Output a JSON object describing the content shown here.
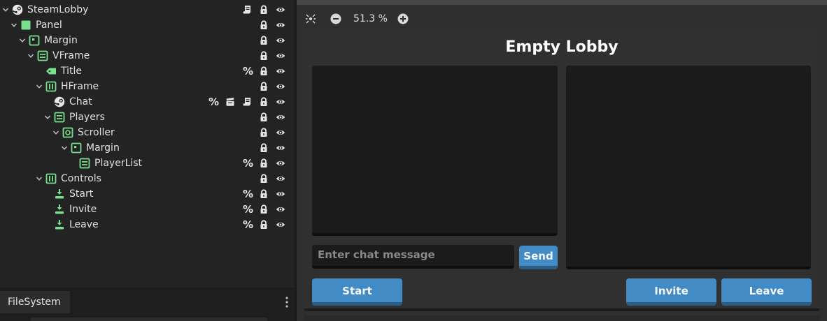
{
  "scene_tree": [
    {
      "id": "steamlobby",
      "label": "SteamLobby",
      "depth": 0,
      "chevron": true,
      "icon": "steam-node-icon",
      "percent": false,
      "clapper": false,
      "script": true
    },
    {
      "id": "panel",
      "label": "Panel",
      "depth": 1,
      "chevron": true,
      "icon": "panel-node-icon",
      "percent": false,
      "clapper": false,
      "script": false
    },
    {
      "id": "margin",
      "label": "Margin",
      "depth": 2,
      "chevron": true,
      "icon": "margin-container-icon",
      "percent": false,
      "clapper": false,
      "script": false
    },
    {
      "id": "vframe",
      "label": "VFrame",
      "depth": 3,
      "chevron": true,
      "icon": "vbox-container-icon",
      "percent": false,
      "clapper": false,
      "script": false
    },
    {
      "id": "title",
      "label": "Title",
      "depth": 4,
      "chevron": false,
      "icon": "label-node-icon",
      "percent": true,
      "clapper": false,
      "script": false
    },
    {
      "id": "hframe",
      "label": "HFrame",
      "depth": 4,
      "chevron": true,
      "icon": "hbox-container-icon",
      "percent": false,
      "clapper": false,
      "script": false
    },
    {
      "id": "chat",
      "label": "Chat",
      "depth": 5,
      "chevron": false,
      "icon": "steam-node-icon",
      "percent": true,
      "clapper": true,
      "script": true
    },
    {
      "id": "players",
      "label": "Players",
      "depth": 5,
      "chevron": true,
      "icon": "vbox-container-icon",
      "percent": false,
      "clapper": false,
      "script": false
    },
    {
      "id": "scroller",
      "label": "Scroller",
      "depth": 6,
      "chevron": true,
      "icon": "scroll-container-icon",
      "percent": false,
      "clapper": false,
      "script": false
    },
    {
      "id": "margin2",
      "label": "Margin",
      "depth": 7,
      "chevron": true,
      "icon": "margin-container-icon",
      "percent": false,
      "clapper": false,
      "script": false
    },
    {
      "id": "playerlist",
      "label": "PlayerList",
      "depth": 8,
      "chevron": false,
      "icon": "vbox-container-icon",
      "percent": true,
      "clapper": false,
      "script": false
    },
    {
      "id": "controls",
      "label": "Controls",
      "depth": 4,
      "chevron": true,
      "icon": "hbox-container-icon",
      "percent": false,
      "clapper": false,
      "script": false
    },
    {
      "id": "start",
      "label": "Start",
      "depth": 5,
      "chevron": false,
      "icon": "button-node-icon",
      "percent": true,
      "clapper": false,
      "script": false
    },
    {
      "id": "invite",
      "label": "Invite",
      "depth": 5,
      "chevron": false,
      "icon": "button-node-icon",
      "percent": true,
      "clapper": false,
      "script": false
    },
    {
      "id": "leave",
      "label": "Leave",
      "depth": 5,
      "chevron": false,
      "icon": "button-node-icon",
      "percent": true,
      "clapper": false,
      "script": false
    }
  ],
  "percent_symbol": "%",
  "bottom_dock": {
    "tab_label": "FileSystem"
  },
  "viewport": {
    "zoom_label": "51.3 %",
    "lobby": {
      "title": "Empty Lobby",
      "chat_placeholder": "Enter chat message",
      "send_label": "Send",
      "start_label": "Start",
      "invite_label": "Invite",
      "leave_label": "Leave"
    }
  },
  "colors": {
    "node_green": "#79e18d",
    "button_blue": "#438bc4",
    "editor_bg": "#232323"
  }
}
